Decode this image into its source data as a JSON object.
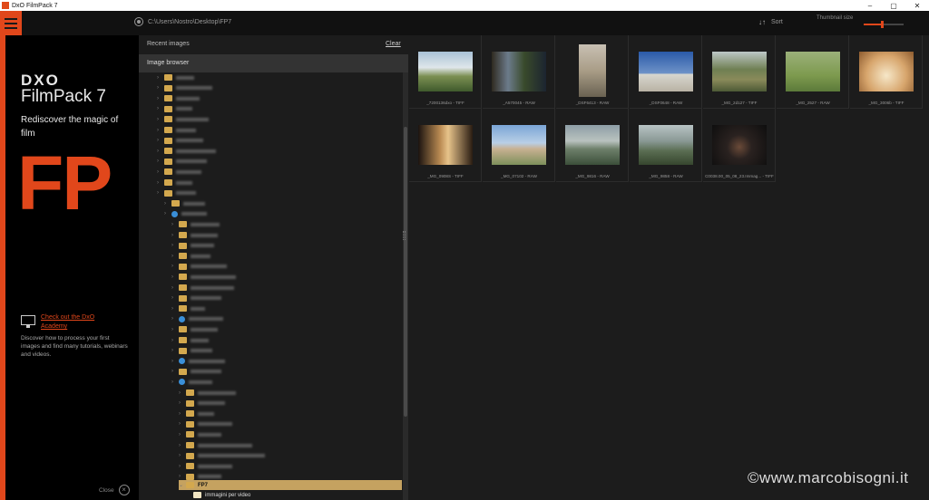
{
  "window": {
    "title": "DxO FilmPack 7",
    "controls": [
      "–",
      "▢",
      "✕"
    ]
  },
  "toolbar": {
    "path": "C:\\Users\\Nostro\\Desktop\\FP7",
    "sort_label": "Sort",
    "sort_icon": "↓↑",
    "thumbnail_size_label": "Thumbnail size",
    "thumbnail_size_level": 0.46
  },
  "promo": {
    "logo_dxo": "DXO",
    "logo_product": "FilmPack 7",
    "tagline": "Rediscover the magic of film",
    "big_logo": "FP",
    "academy_link": "Check out the DxO Academy",
    "discover_text": "Discover how to process your first images and find many tutorials, webinars and videos.",
    "close_label": "Close",
    "accent_color": "#e1471b"
  },
  "browser": {
    "recent_label": "Recent images",
    "clear_label": "Clear",
    "header": "Image browser",
    "selected_folder": "FP7",
    "subfolder": "immagini per video",
    "folder_color": "#d3a84e"
  },
  "thumbnails": [
    {
      "caption": "_7200136dxo - TIFF"
    },
    {
      "caption": "_A570045 - RAW"
    },
    {
      "caption": "_DSF6413 - RAW"
    },
    {
      "caption": "_DSF0648 - RAW"
    },
    {
      "caption": "_MG_2d127 - TIFF"
    },
    {
      "caption": "_MG_2527 - RAW"
    },
    {
      "caption": "_MG_3006b - TIFF"
    },
    {
      "caption": "_MG_0908S - TIFF"
    },
    {
      "caption": "_MG_07102 - RAW"
    },
    {
      "caption": "_MG_9816 - RAW"
    },
    {
      "caption": "_MG_9858 - RAW"
    },
    {
      "caption": "C0038.00_05_08_23.Immag... - TIFF"
    }
  ],
  "watermark": "©www.marcobisogni.it"
}
